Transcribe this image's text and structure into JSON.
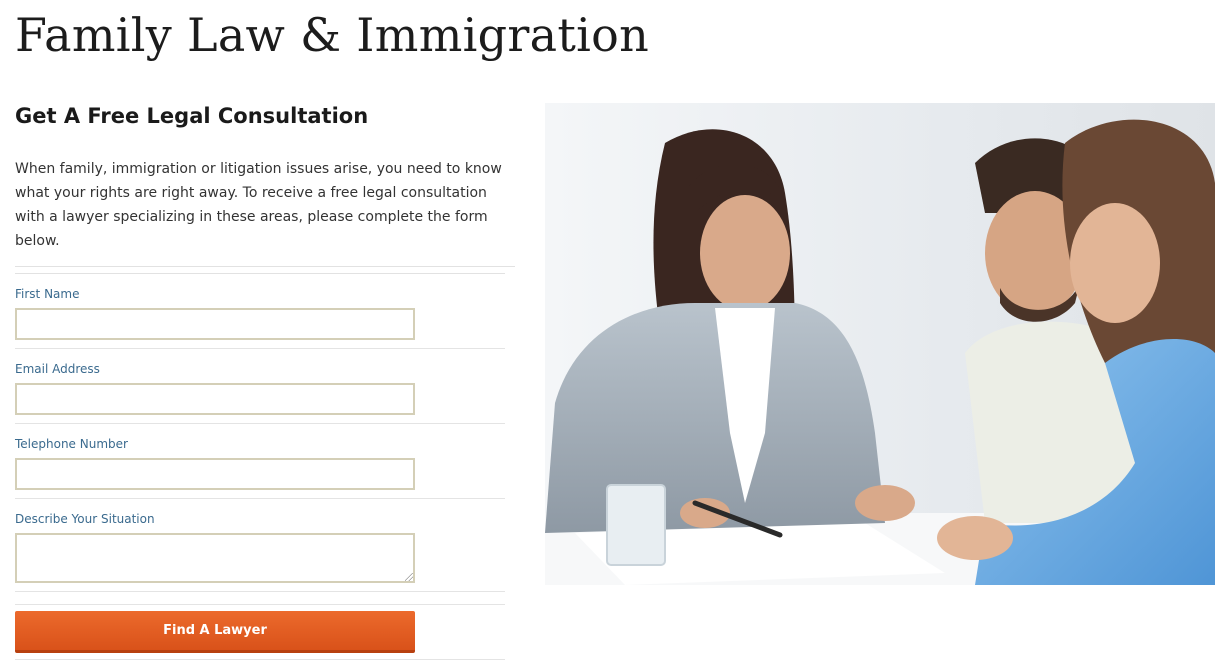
{
  "header": {
    "title": "Family Law & Immigration"
  },
  "consultation": {
    "heading": "Get A Free Legal Consultation",
    "intro": "When family, immigration or litigation issues arise, you need to know what your rights are right away. To receive a free legal consultation with a lawyer specializing in these areas, please complete the form below."
  },
  "form": {
    "fields": [
      {
        "label": "First Name",
        "value": ""
      },
      {
        "label": "Email Address",
        "value": ""
      },
      {
        "label": "Telephone Number",
        "value": ""
      },
      {
        "label": "Describe Your Situation",
        "value": ""
      }
    ],
    "submit_label": "Find A Lawyer",
    "button_color": "#e25b20",
    "label_color": "#3a6a8e",
    "input_border_color": "#d4cfb7"
  },
  "photo": {
    "description_icon": "lawyer-meeting-couple-photo"
  }
}
